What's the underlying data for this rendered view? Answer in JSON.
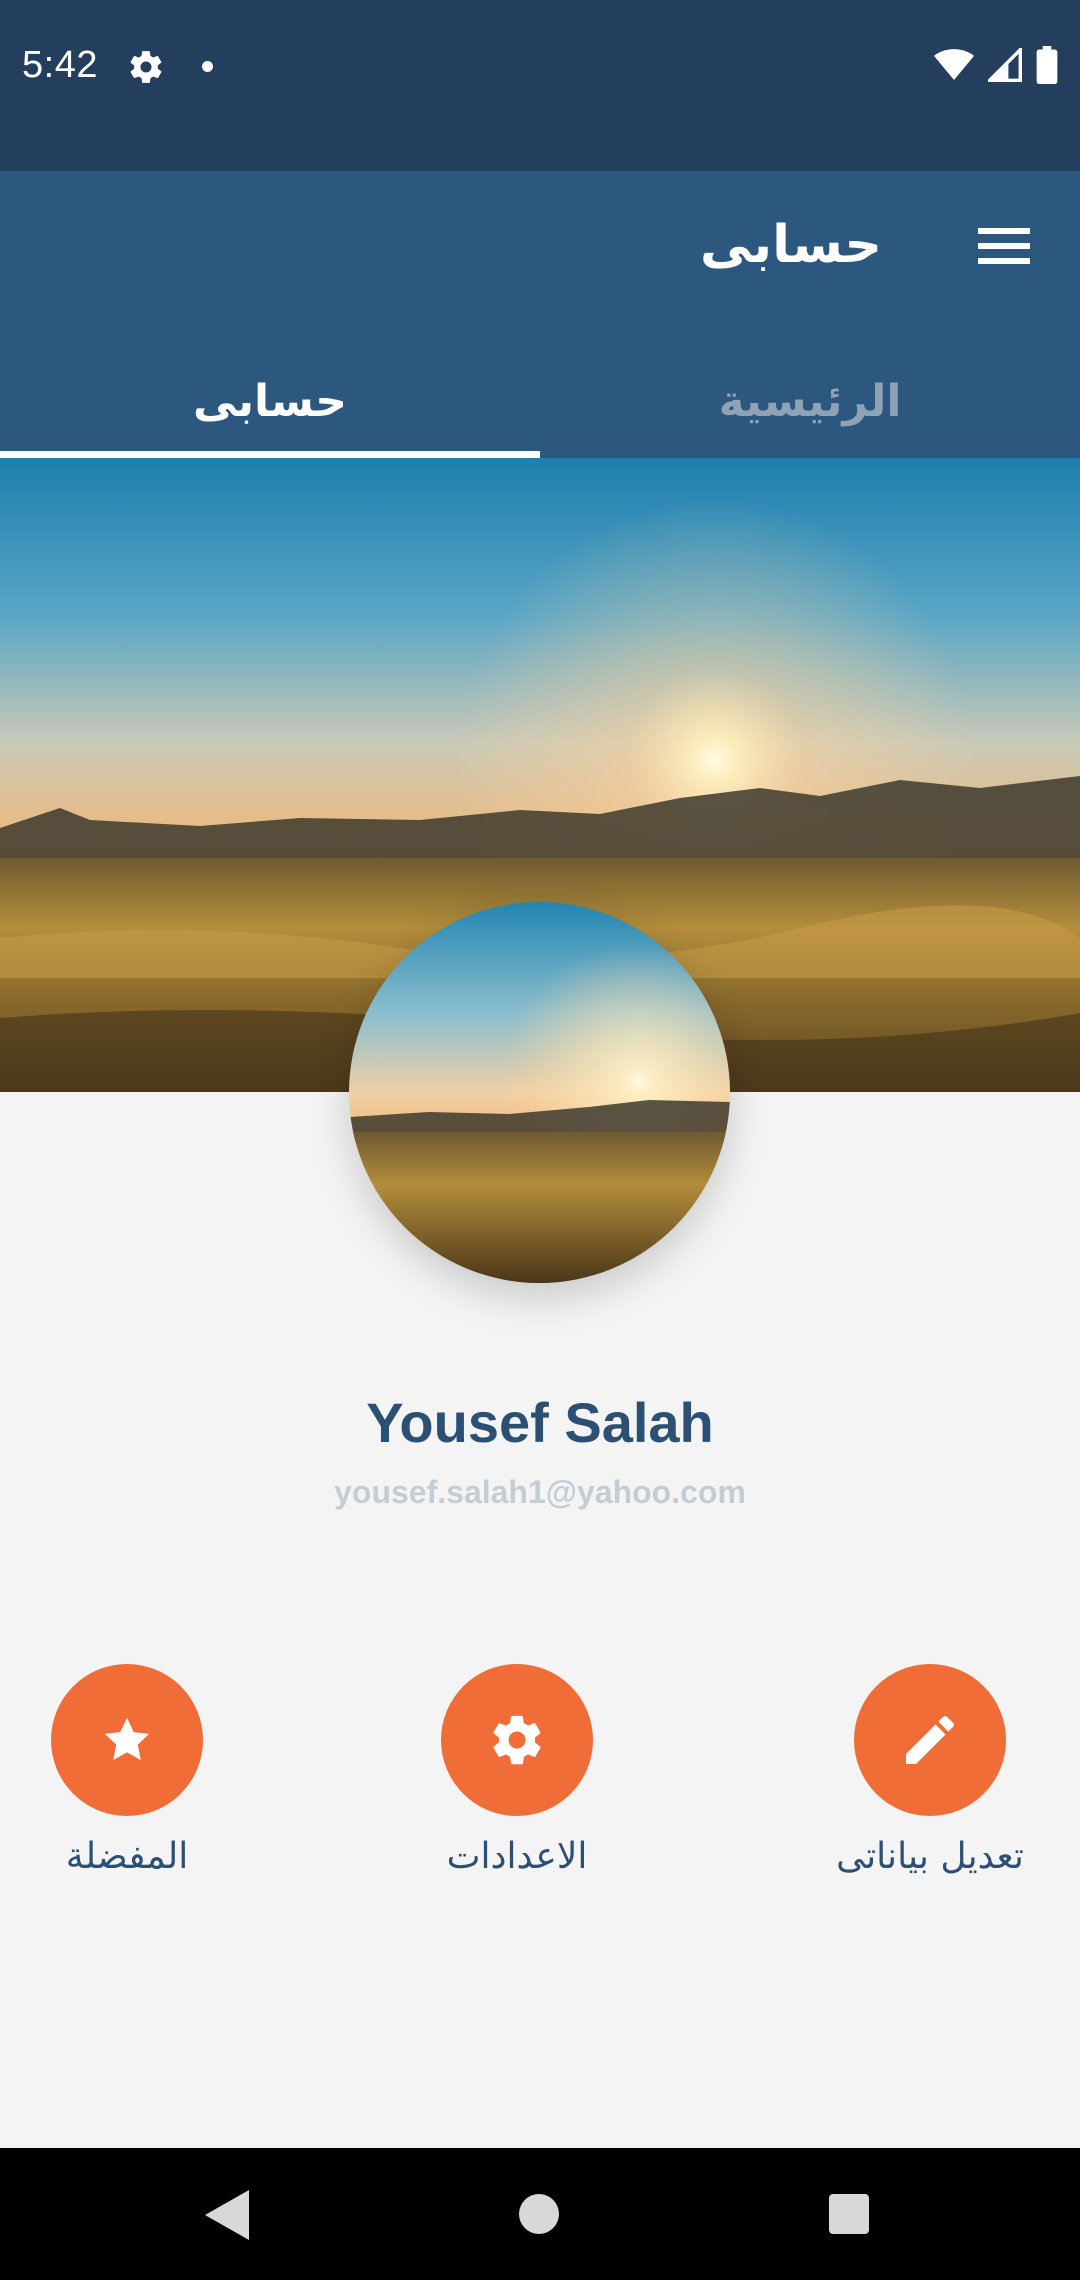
{
  "status_bar": {
    "time": "5:42",
    "icons": [
      "settings-icon",
      "notification-dot-icon",
      "wifi-icon",
      "cell-signal-icon",
      "battery-icon"
    ]
  },
  "app_bar": {
    "title": "حسابى",
    "menu_icon": "hamburger-menu-icon"
  },
  "tabs": [
    {
      "label": "الرئيسية",
      "active": false
    },
    {
      "label": "حسابى",
      "active": true
    }
  ],
  "profile": {
    "name": "Yousef Salah",
    "email": "yousef.salah1@yahoo.com"
  },
  "actions": [
    {
      "label": "المفضلة",
      "icon": "star-icon"
    },
    {
      "label": "الاعدادات",
      "icon": "gear-icon"
    },
    {
      "label": "تعديل بياناتى",
      "icon": "pencil-icon"
    }
  ],
  "colors": {
    "status_bar": "#243f5d",
    "app_bar": "#2c577e",
    "accent": "#f06d38",
    "text_primary": "#2c4f74",
    "text_secondary": "#c3cdd6"
  },
  "navigation": {
    "icons": [
      "back-icon",
      "home-icon",
      "recent-apps-icon"
    ]
  }
}
